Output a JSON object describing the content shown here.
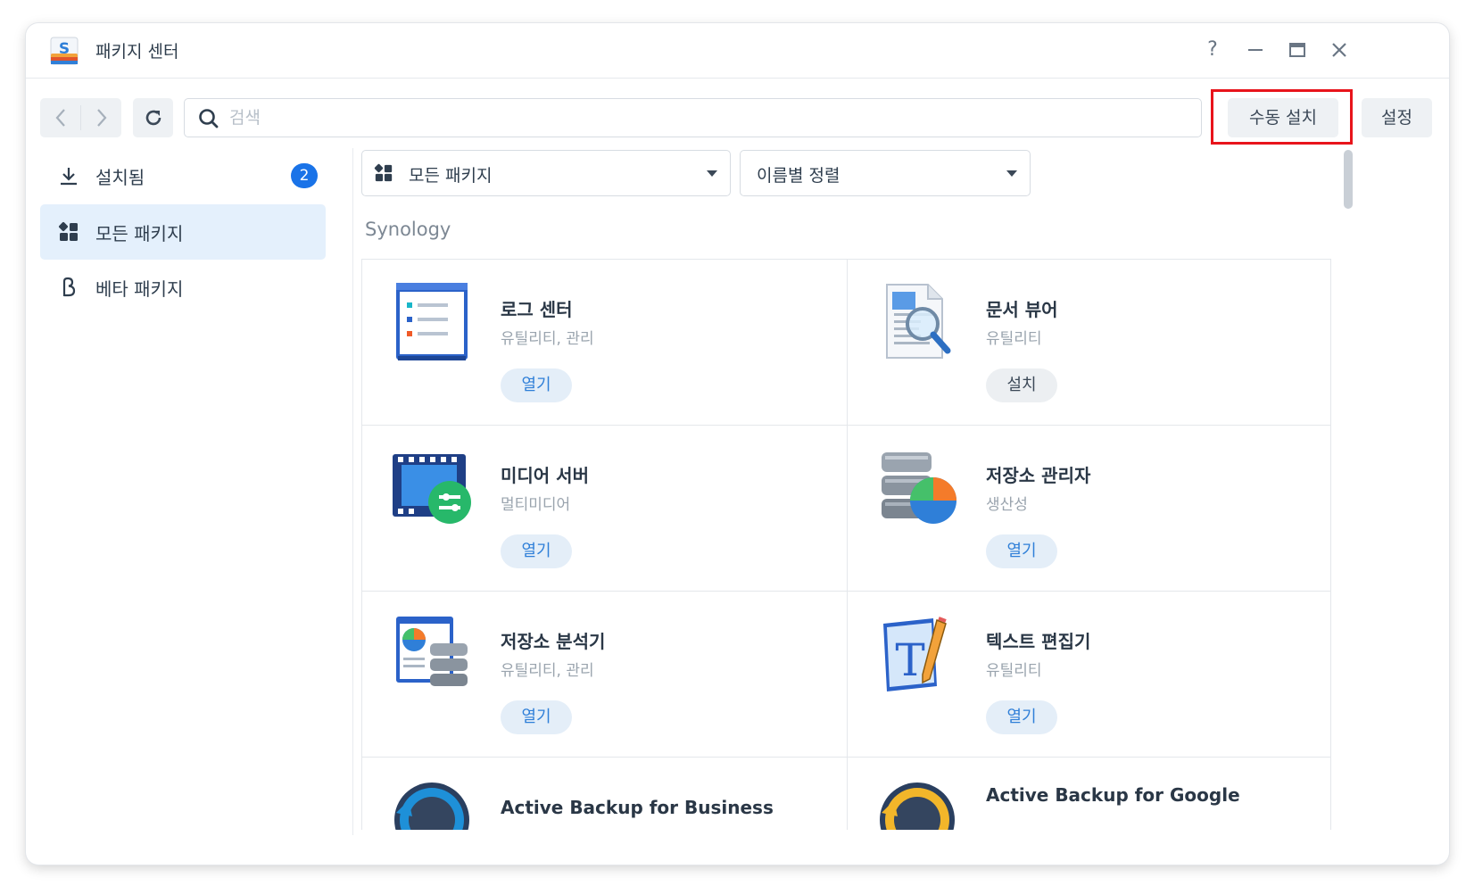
{
  "window": {
    "title": "패키지 센터"
  },
  "titlebar": {
    "help": "?",
    "minimize": "—",
    "maximize": "▭",
    "close": "✕"
  },
  "toolbar": {
    "search_placeholder": "검색",
    "manual_install_label": "수동 설치",
    "settings_label": "설정"
  },
  "sidebar": {
    "items": [
      {
        "label": "설치됨",
        "icon": "download-icon",
        "badge": "2"
      },
      {
        "label": "모든 패키지",
        "icon": "grid-icon",
        "active": true
      },
      {
        "label": "베타 패키지",
        "icon": "beta-icon"
      }
    ]
  },
  "filters": {
    "category_label": "모든 패키지",
    "sort_label": "이름별 정렬"
  },
  "section": {
    "title": "Synology"
  },
  "packages": [
    {
      "name": "로그 센터",
      "category": "유틸리티, 관리",
      "action": "열기",
      "icon": "log-center-icon"
    },
    {
      "name": "문서 뷰어",
      "category": "유틸리티",
      "action": "설치",
      "icon": "document-viewer-icon"
    },
    {
      "name": "미디어 서버",
      "category": "멀티미디어",
      "action": "열기",
      "icon": "media-server-icon"
    },
    {
      "name": "저장소 관리자",
      "category": "생산성",
      "action": "열기",
      "icon": "storage-manager-icon"
    },
    {
      "name": "저장소 분석기",
      "category": "유틸리티, 관리",
      "action": "열기",
      "icon": "storage-analyzer-icon"
    },
    {
      "name": "텍스트 편집기",
      "category": "유틸리티",
      "action": "열기",
      "icon": "text-editor-icon"
    },
    {
      "name": "Active Backup for Business",
      "category": "",
      "action": "",
      "icon": "active-backup-business-icon"
    },
    {
      "name": "Active Backup for Google",
      "category": "",
      "action": "",
      "icon": "active-backup-google-icon"
    }
  ],
  "colors": {
    "accent": "#1a73e8",
    "highlight_box": "#e8141b",
    "active_bg": "#e4f0fc"
  }
}
